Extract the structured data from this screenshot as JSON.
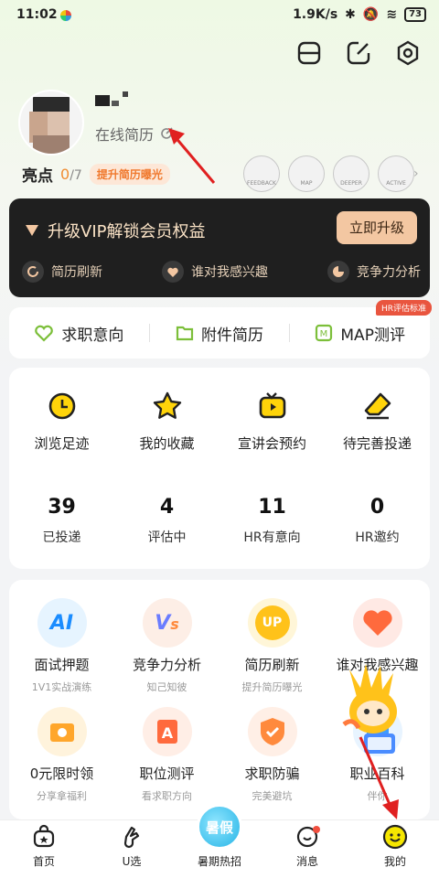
{
  "status_bar": {
    "time": "11:02",
    "net_speed": "1.9K/s",
    "battery": "73"
  },
  "profile": {
    "resume_link": "在线简历"
  },
  "highlights": {
    "label": "亮点",
    "count": "0",
    "total": "/7",
    "boost_label": "提升简历曝光",
    "badges": [
      "FEEDBACK",
      "MAP",
      "DEEPER",
      "ACTIVE"
    ]
  },
  "vip": {
    "title": "升级VIP解锁会员权益",
    "cta": "立即升级",
    "features": [
      "简历刷新",
      "谁对我感兴趣",
      "竞争力分析"
    ]
  },
  "quick": {
    "items": [
      "求职意向",
      "附件简历",
      "MAP测评"
    ],
    "hr_tag": "HR评估标准"
  },
  "tools": {
    "items": [
      "浏览足迹",
      "我的收藏",
      "宣讲会预约",
      "待完善投递"
    ],
    "stats": [
      {
        "num": "39",
        "label": "已投递"
      },
      {
        "num": "4",
        "label": "评估中"
      },
      {
        "num": "11",
        "label": "HR有意向"
      },
      {
        "num": "0",
        "label": "HR邀约"
      }
    ]
  },
  "services": [
    {
      "title": "面试押题",
      "sub": "1V1实战演练",
      "icon": "ai-icon"
    },
    {
      "title": "竞争力分析",
      "sub": "知己知彼",
      "icon": "vs-icon"
    },
    {
      "title": "简历刷新",
      "sub": "提升简历曝光",
      "icon": "up-icon"
    },
    {
      "title": "谁对我感兴趣",
      "sub": "",
      "icon": "heart-icon"
    },
    {
      "title": "0元限时领",
      "sub": "分享拿福利",
      "icon": "gift-icon"
    },
    {
      "title": "职位测评",
      "sub": "看求职方向",
      "icon": "a-icon"
    },
    {
      "title": "求职防骗",
      "sub": "完美避坑",
      "icon": "shield-icon"
    },
    {
      "title": "职业百科",
      "sub": "伴你",
      "icon": "book-icon"
    }
  ],
  "tabbar": {
    "items": [
      "首页",
      "U选",
      "暑期热招",
      "消息",
      "我的"
    ],
    "summer_badge": "暑假"
  },
  "colors": {
    "accent": "#f5b800",
    "vip_gold": "#f3c7a2",
    "hot": "#f04e3e"
  }
}
